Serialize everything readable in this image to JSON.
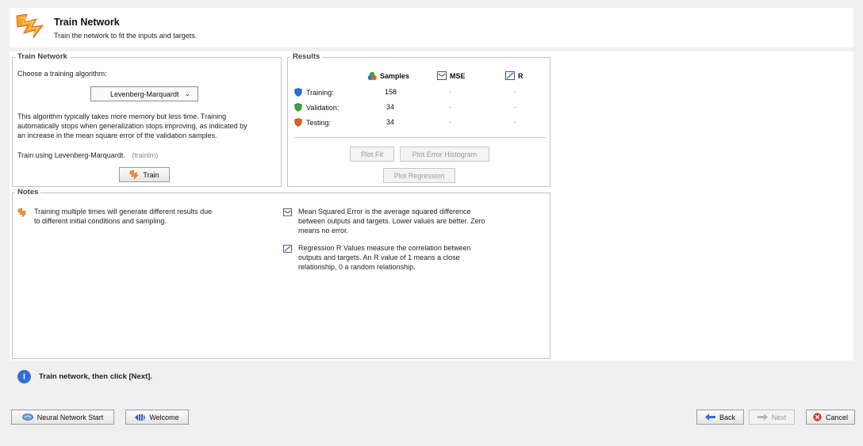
{
  "header": {
    "title": "Train Network",
    "subtitle": "Train the network to fit the inputs and targets."
  },
  "train_panel": {
    "title": "Train Network",
    "choose_label": "Choose a training algorithm:",
    "algorithm_selected": "Levenberg-Marquardt",
    "description_lines": [
      "This algorithm typically takes more memory but less time. Training",
      "automatically stops when generalization stops improving, as indicated by",
      "an increase in the mean square error of the validation samples."
    ],
    "train_using": "Train using Levenberg-Marquardt.",
    "train_fn": "(trainlm)",
    "train_button": "Train"
  },
  "results": {
    "title": "Results",
    "columns": [
      "Samples",
      "MSE",
      "R"
    ],
    "rows": [
      {
        "label": "Training:",
        "samples": "158",
        "mse": "-",
        "r": "-"
      },
      {
        "label": "Validation:",
        "samples": "34",
        "mse": "-",
        "r": "-"
      },
      {
        "label": "Testing:",
        "samples": "34",
        "mse": "-",
        "r": "-"
      }
    ],
    "plot_fit": "Plot Fit",
    "plot_error_histogram": "Plot Error Histogram",
    "plot_regression": "Plot Regression"
  },
  "notes": {
    "title": "Notes",
    "training_note": [
      "Training multiple times will generate different results due",
      "to different initial conditions and sampling."
    ],
    "mse_note": [
      "Mean Squared Error is the average squared difference",
      "between outputs and targets. Lower values are better. Zero",
      "means no error."
    ],
    "r_note": [
      "Regression R Values measure the correlation between",
      "outputs and targets. An R value of 1 means a close",
      "relationship, 0 a random relationship."
    ]
  },
  "status": {
    "message": "Train network, then click [Next]."
  },
  "footer": {
    "nn_start": "Neural Network Start",
    "welcome": "Welcome",
    "back": "Back",
    "next": "Next",
    "cancel": "Cancel"
  },
  "colors": {
    "training": "#2a6fd6",
    "validation": "#3aa33a",
    "testing": "#e2601c",
    "accent_orange": "#f39a1b"
  }
}
